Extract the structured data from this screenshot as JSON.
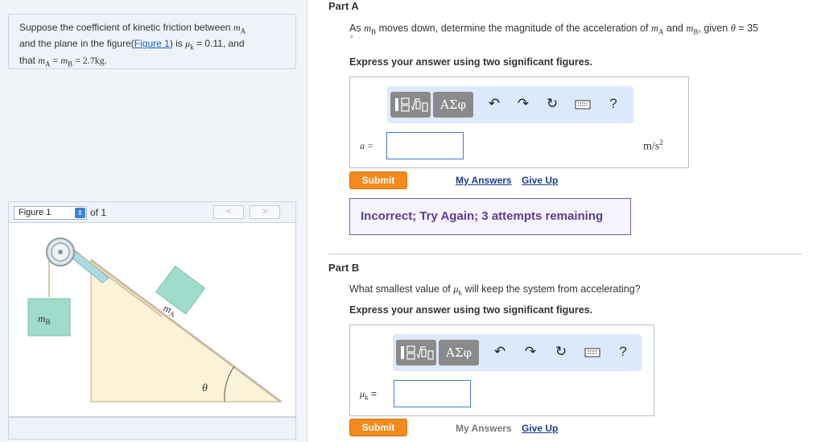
{
  "problem": {
    "t1": "Suppose the coefficient of kinetic friction between ",
    "mA_m": "m",
    "mA_sub": "A",
    "t2": "and the plane in the figure(",
    "figure_link": "Figure 1",
    "t3": ") is ",
    "mu_k": "μ",
    "mu_sub": "k",
    "mu_val": " = 0.11, and",
    "t4": "that ",
    "eq": " = ",
    "mass_val": " = 2.7kg."
  },
  "figure_nav": {
    "select_value": "Figure 1",
    "of_label": "of 1",
    "prev": "<",
    "next": ">"
  },
  "figure": {
    "mass_b_label": "m",
    "mass_b_sub": "B",
    "mass_a_label": "m",
    "mass_a_sub": "A",
    "theta": "θ"
  },
  "partA": {
    "title": "Part A",
    "q1": "As ",
    "q2": " moves down, determine the magnitude of the acceleration of ",
    "q3": " and ",
    "q4": ", given ",
    "theta": "θ",
    "q5": " = 35",
    "degree": "∘",
    "period": ".",
    "instruction": "Express your answer using two significant figures.",
    "var_label": "a =",
    "unit": "m/s",
    "unit_exp": "2",
    "submit": "Submit",
    "my_answers": "My Answers",
    "give_up": "Give Up",
    "feedback": "Incorrect; Try Again; 3 attempts remaining"
  },
  "partB": {
    "title": "Part B",
    "q1": "What smallest value of ",
    "q2": " will keep the system from accelerating?",
    "instruction": "Express your answer using two significant figures.",
    "var_label": "=",
    "submit": "Submit",
    "my_answers": "My Answers",
    "give_up": "Give Up"
  },
  "toolbar": {
    "greek": "ΑΣφ",
    "help": "?"
  },
  "colors": {
    "submit_orange": "#f28a1d",
    "feedback_purple": "#5c3d8f",
    "toolbar_bg": "#dce9fb",
    "link_blue": "#1b3f87"
  }
}
